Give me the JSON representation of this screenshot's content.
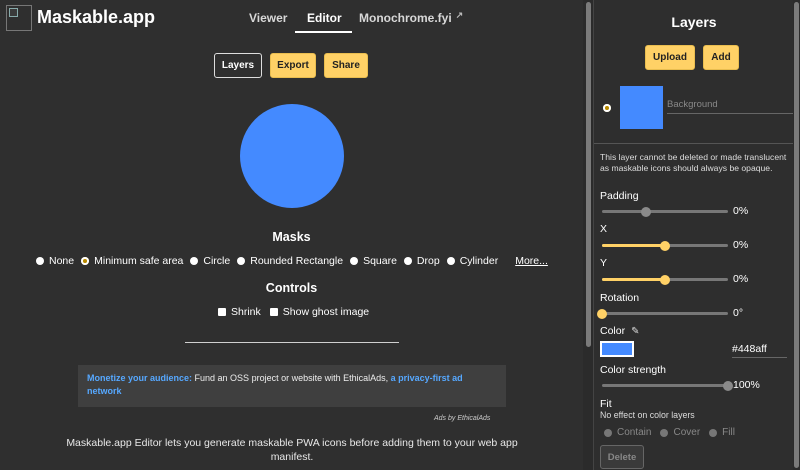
{
  "header": {
    "title": "Maskable.app",
    "nav": [
      {
        "label": "Viewer"
      },
      {
        "label": "Editor"
      },
      {
        "label": "Monochrome.fyi"
      }
    ]
  },
  "toolbar": {
    "layers_label": "Layers",
    "export_label": "Export",
    "share_label": "Share"
  },
  "preview": {
    "color": "#448aff"
  },
  "masks": {
    "title": "Masks",
    "options": [
      "None",
      "Minimum safe area",
      "Circle",
      "Rounded Rectangle",
      "Square",
      "Drop",
      "Cylinder"
    ],
    "selected": "Minimum safe area",
    "more_label": "More..."
  },
  "controls": {
    "title": "Controls",
    "shrink_label": "Shrink",
    "ghost_label": "Show ghost image"
  },
  "ad": {
    "strong": "Monetize your audience:",
    "text": " Fund an OSS project or website with EthicalAds, ",
    "link": "a privacy-first ad network",
    "footer": "Ads by EthicalAds"
  },
  "description": "Maskable.app Editor lets you generate maskable PWA icons before adding them to your web app manifest.",
  "sidebar": {
    "title": "Layers",
    "upload_label": "Upload",
    "add_label": "Add",
    "layer": {
      "name_placeholder": "Background",
      "color": "#448aff"
    },
    "info": "This layer cannot be deleted or made translucent as maskable icons should always be opaque.",
    "padding": {
      "label": "Padding",
      "value": "0%",
      "fraction": 0.35,
      "active": false
    },
    "x": {
      "label": "X",
      "value": "0%",
      "fraction": 0.5,
      "active": true
    },
    "y": {
      "label": "Y",
      "value": "0%",
      "fraction": 0.5,
      "active": true
    },
    "rotation": {
      "label": "Rotation",
      "value": "0°",
      "fraction": 0.0,
      "active": true
    },
    "color": {
      "label": "Color",
      "hex": "#448aff"
    },
    "color_strength": {
      "label": "Color strength",
      "value": "100%",
      "fraction": 1.0,
      "active": false
    },
    "fit": {
      "label": "Fit",
      "note": "No effect on color layers",
      "options": [
        "Contain",
        "Cover",
        "Fill"
      ]
    },
    "delete_label": "Delete"
  },
  "colors": {
    "accent": "#ffd166",
    "background": "#2f2f2f",
    "link": "#56a8ff"
  }
}
